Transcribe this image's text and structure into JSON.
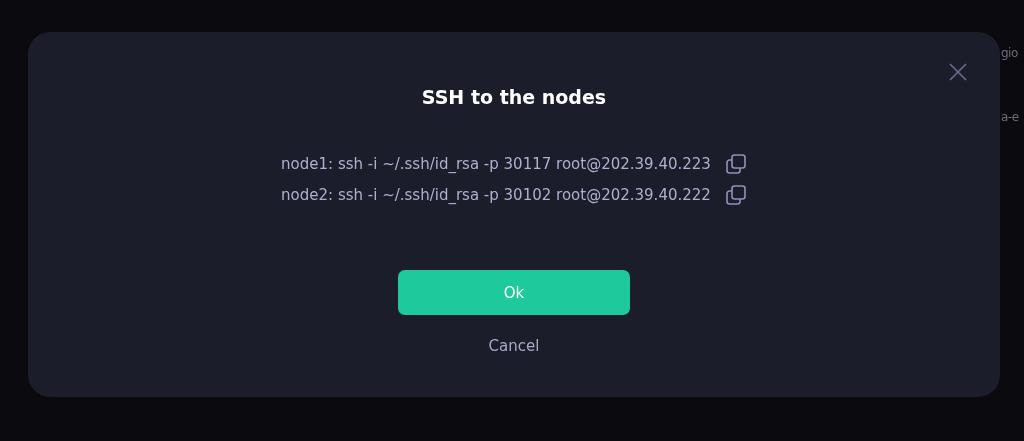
{
  "background": {
    "texts": [
      "gio",
      "a-e"
    ]
  },
  "dialog": {
    "title": "SSH to the nodes",
    "commands": [
      {
        "text": "node1: ssh -i ~/.ssh/id_rsa -p 30117 root@202.39.40.223"
      },
      {
        "text": "node2: ssh -i ~/.ssh/id_rsa -p 30102 root@202.39.40.222"
      }
    ],
    "primary_button": "Ok",
    "secondary_button": "Cancel"
  }
}
